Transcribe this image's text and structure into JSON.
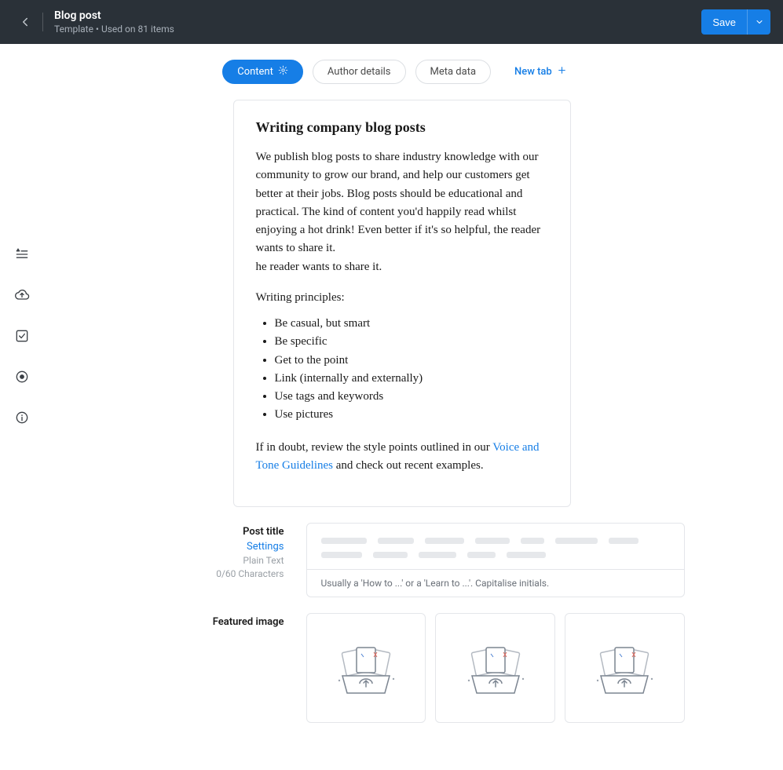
{
  "header": {
    "title": "Blog post",
    "subtitle": "Template • Used on 81 items",
    "save_label": "Save"
  },
  "tabs": {
    "content": "Content",
    "author": "Author details",
    "meta": "Meta data",
    "new": "New tab"
  },
  "instructions": {
    "heading": "Writing company blog posts",
    "para1": "We publish blog posts to share industry knowledge with our community to grow our brand, and help our customers get better at their jobs. Blog posts should be educational and practical. The kind of content you'd happily read whilst enjoying a hot drink! Even better if it's so helpful, the reader wants to share it.",
    "para1b": "he reader wants to share it.",
    "principles_label": "Writing principles:",
    "principles": [
      "Be casual, but smart",
      "Be specific",
      "Get to the point",
      "Link (internally and externally)",
      "Use tags and keywords",
      "Use pictures"
    ],
    "closing_prefix": "If in doubt, review the style points outlined in our ",
    "closing_link": "Voice and Tone Guidelines",
    "closing_suffix": " and check out recent examples."
  },
  "fields": {
    "post_title": {
      "label": "Post title",
      "settings": "Settings",
      "type": "Plain Text",
      "count": "0/60 Characters",
      "hint": "Usually a 'How to ...' or a 'Learn to ...'. Capitalise initials."
    },
    "featured_image": {
      "label": "Featured image"
    }
  }
}
